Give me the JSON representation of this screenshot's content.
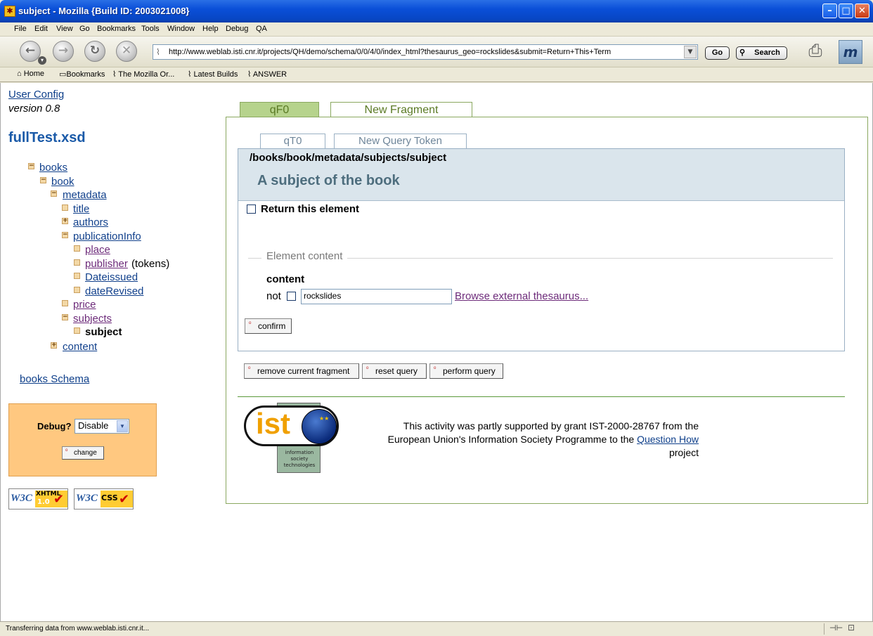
{
  "window": {
    "title": "subject - Mozilla {Build ID: 2003021008}"
  },
  "menu": [
    "File",
    "Edit",
    "View",
    "Go",
    "Bookmarks",
    "Tools",
    "Window",
    "Help",
    "Debug",
    "QA"
  ],
  "nav": {
    "url": "http://www.weblab.isti.cnr.it/projects/QH/demo/schema/0/0/4/0/index_html?thesaurus_geo=rockslides&submit=Return+This+Term",
    "go_label": "Go",
    "search_label": "Search"
  },
  "bookmarks": [
    "Home",
    "Bookmarks",
    "The Mozilla Or...",
    "Latest Builds",
    "ANSWER"
  ],
  "sidebar": {
    "user_config": "User Config",
    "version": "version 0.8",
    "schema_file": "fullTest.xsd",
    "tree": {
      "books": "books",
      "book": "book",
      "metadata": "metadata",
      "title": "title",
      "authors": "authors",
      "publicationInfo": "publicationInfo",
      "place": "place",
      "publisher": "publisher",
      "publisher_note": "(tokens)",
      "dateissued": "Dateissued",
      "dateRevised": "dateRevised",
      "price": "price",
      "subjects": "subjects",
      "subject": "subject",
      "content": "content"
    },
    "schema_link": "books Schema",
    "debug": {
      "label": "Debug?",
      "value": "Disable",
      "change_label": "change"
    },
    "badges": {
      "xhtml": [
        "W3C",
        "XHTML",
        "1.0"
      ],
      "css": [
        "W3C",
        "CSS"
      ]
    }
  },
  "main": {
    "fragment_tabs": [
      "qF0",
      "New Fragment"
    ],
    "token_tabs": [
      "qT0",
      "New Query Token"
    ],
    "path": "/books/book/metadata/subjects/subject",
    "description": "A subject of the book",
    "return_label": "Return this element",
    "element_content_legend": "Element content",
    "content_label": "content",
    "not_label": "not",
    "content_value": "rockslides",
    "thesaurus_link": "Browse external thesaurus...",
    "confirm_label": "confirm",
    "actions": [
      "remove current fragment",
      "reset query",
      "perform query"
    ],
    "logo": {
      "text": "ist",
      "sub": [
        "information",
        "society",
        "technologies"
      ]
    },
    "footer_text_1": "This activity was partly supported by grant IST-2000-28767 from the",
    "footer_text_2": "European Union's Information Society Programme to the",
    "footer_link": "Question How",
    "footer_text_3": "project"
  },
  "status": {
    "text": "Transferring data from www.weblab.isti.cnr.it..."
  }
}
